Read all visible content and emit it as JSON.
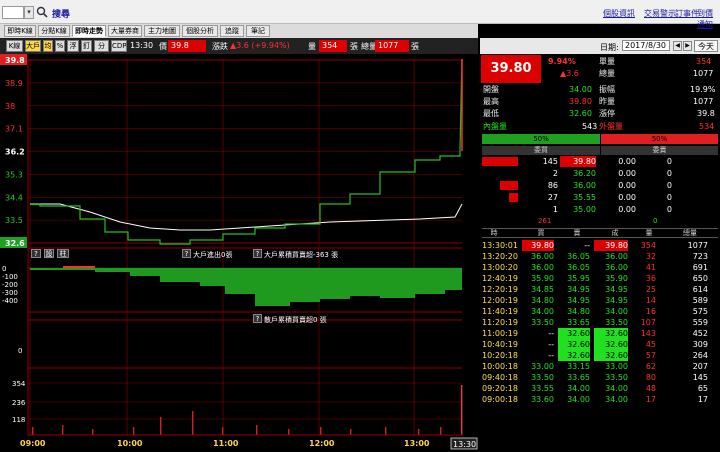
{
  "topbar": {
    "stock_code": "",
    "dropdown": "▾",
    "search_icon": "search-icon",
    "search_label": "搜尋",
    "links": [
      "個股資訊",
      "交易警示",
      "訂事件",
      "到價通知"
    ]
  },
  "tabs": [
    "即時K線",
    "分點K線",
    "即時走勢",
    "大量券商",
    "主力地圖",
    "個股分析",
    "追蹤",
    "筆記"
  ],
  "active_tab": 2,
  "toolbar": {
    "buttons": [
      "K線",
      "大戶",
      "均",
      "%",
      "浮",
      "釘",
      "分價",
      "CDP"
    ],
    "active_buttons": [
      1,
      2
    ],
    "time": "13:30",
    "price_label": "價",
    "price": "39.8",
    "change_label": "漲跌",
    "change": "▲3.6 (+9.94%)",
    "volume_label": "量",
    "volume": "354",
    "volume_unit": "張",
    "total_label": "總量",
    "total": "1077",
    "total_unit": "張"
  },
  "chart": {
    "price_axis": [
      "39.8",
      "38.9",
      "38",
      "37.1",
      "36.2",
      "35.3",
      "34.4",
      "33.5",
      "32.6"
    ],
    "big_buttons": [
      "?",
      "設",
      "柱"
    ],
    "big_label_1": "大戶進出0張",
    "big_label_2": "大戶累積買賣超-363 張",
    "retail_label": "散戶累積買賣超0 張",
    "flow_axis": [
      "0",
      "-100",
      "-200",
      "-300",
      "-400"
    ],
    "mid_axis": [
      "0"
    ],
    "vol_axis": [
      "354",
      "236",
      "118"
    ],
    "time_labels": [
      "09:00",
      "10:00",
      "11:00",
      "12:00",
      "13:00"
    ],
    "current_time": "13:30",
    "colors": {
      "price_line": "#20c020",
      "avg_line": "#ffffff",
      "flow_fill": "#1f9a1f",
      "grid": "#8b0000"
    }
  },
  "chart_data": {
    "type": "line",
    "x": [
      "09:00",
      "09:30",
      "10:00",
      "10:30",
      "11:00",
      "11:30",
      "12:00",
      "12:30",
      "13:00",
      "13:25",
      "13:30"
    ],
    "series": [],
    "ylim": [
      32.6,
      39.8
    ]
  },
  "right": {
    "date_label": "日期:",
    "date_value": "2017/8/30",
    "prev": "◀",
    "next": "▶",
    "today_btn": "今天",
    "big_price": "39.80",
    "pct": "9.94%",
    "chg": "▲3.6",
    "single_label": "單量",
    "single_val": "354",
    "total_label": "總量",
    "total_val": "1077",
    "open_label": "開盤",
    "open_val": "34.00",
    "amp_label": "振幅",
    "amp_val": "19.9%",
    "high_label": "最高",
    "high_val": "39.80",
    "prev_vol_label": "昨量",
    "prev_vol_val": "1077",
    "low_label": "最低",
    "low_val": "32.60",
    "limit_label": "漲停",
    "limit_val": "39.8",
    "inner_label": "內盤量",
    "inner_val": "543",
    "outer_label": "外盤量",
    "outer_val": "534",
    "inner_pct": "50%",
    "outer_pct": "50%",
    "buy_head": "委買",
    "sell_head": "委賣",
    "book": [
      [
        "145",
        "39.80",
        "0.00",
        "0"
      ],
      [
        "2",
        "36.20",
        "0.00",
        "0"
      ],
      [
        "86",
        "36.00",
        "0.00",
        "0"
      ],
      [
        "27",
        "35.55",
        "0.00",
        "0"
      ],
      [
        "1",
        "35.00",
        "0.00",
        "0"
      ]
    ],
    "book_bars": [
      1.0,
      0,
      0.5,
      0.25,
      0
    ],
    "bar_totals": [
      "261",
      "0"
    ],
    "trade_headers": [
      "時",
      "買",
      "賣",
      "成",
      "量",
      "總量"
    ],
    "trades": [
      [
        "13:30:01",
        "39.80",
        "--",
        "39.80",
        "354",
        "1077"
      ],
      [
        "13:20:20",
        "36.00",
        "36.05",
        "36.00",
        "32",
        "723"
      ],
      [
        "13:00:20",
        "36.00",
        "36.05",
        "36.00",
        "41",
        "691"
      ],
      [
        "12:40:19",
        "35.90",
        "35.95",
        "35.90",
        "36",
        "650"
      ],
      [
        "12:20:19",
        "34.85",
        "34.95",
        "34.95",
        "25",
        "614"
      ],
      [
        "12:00:19",
        "34.80",
        "34.95",
        "34.95",
        "14",
        "589"
      ],
      [
        "11:40:19",
        "34.00",
        "34.80",
        "34.00",
        "16",
        "575"
      ],
      [
        "11:20:19",
        "33.50",
        "33.65",
        "33.50",
        "107",
        "559"
      ],
      [
        "11:00:19",
        "--",
        "32.60",
        "32.60",
        "143",
        "452"
      ],
      [
        "10:40:19",
        "--",
        "32.60",
        "32.60",
        "45",
        "309"
      ],
      [
        "10:20:18",
        "--",
        "32.60",
        "32.60",
        "57",
        "264"
      ],
      [
        "10:00:18",
        "33.00",
        "33.15",
        "33.00",
        "62",
        "207"
      ],
      [
        "09:40:18",
        "33.50",
        "33.65",
        "33.50",
        "80",
        "145"
      ],
      [
        "09:20:18",
        "33.55",
        "34.00",
        "34.00",
        "48",
        "65"
      ],
      [
        "09:00:18",
        "33.60",
        "34.00",
        "34.00",
        "17",
        "17"
      ]
    ]
  }
}
